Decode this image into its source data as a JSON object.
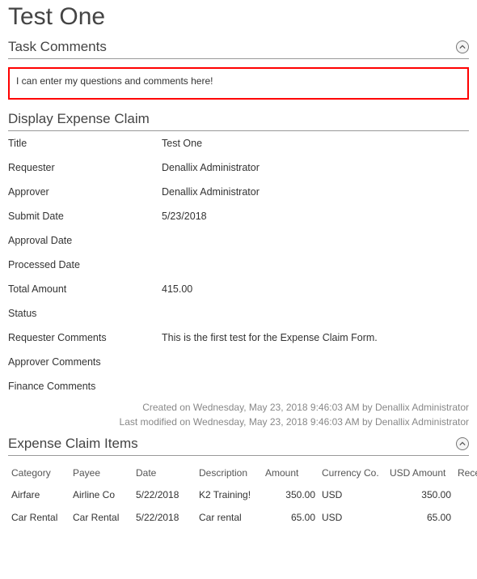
{
  "title": "Test One",
  "sections": {
    "task_comments": {
      "title": "Task Comments"
    },
    "display_claim": {
      "title": "Display Expense Claim"
    },
    "items": {
      "title": "Expense Claim Items"
    }
  },
  "task_comments": {
    "value": "I can enter my questions and comments here!"
  },
  "claim": {
    "labels": {
      "title": "Title",
      "requester": "Requester",
      "approver": "Approver",
      "submit_date": "Submit Date",
      "approval_date": "Approval Date",
      "processed_date": "Processed Date",
      "total_amount": "Total Amount",
      "status": "Status",
      "requester_comments": "Requester Comments",
      "approver_comments": "Approver Comments",
      "finance_comments": "Finance Comments"
    },
    "values": {
      "title": "Test One",
      "requester": "Denallix Administrator",
      "approver": "Denallix Administrator",
      "submit_date": "5/23/2018",
      "approval_date": "",
      "processed_date": "",
      "total_amount": "415.00",
      "status": "",
      "requester_comments": "This is the first test for the Expense Claim Form.",
      "approver_comments": "",
      "finance_comments": ""
    }
  },
  "audit": {
    "created": "Created on  Wednesday, May 23, 2018 9:46:03 AM by  Denallix Administrator",
    "modified": "Last modified on  Wednesday, May 23, 2018 9:46:03 AM by  Denallix Administrator"
  },
  "items": {
    "headers": {
      "category": "Category",
      "payee": "Payee",
      "date": "Date",
      "description": "Description",
      "amount": "Amount",
      "currency": "Currency Co.",
      "usd_amount": "USD Amount",
      "receipt": "Receipt"
    },
    "rows": [
      {
        "category": "Airfare",
        "payee": "Airline Co",
        "date": "5/22/2018",
        "description": "K2 Training!",
        "amount": "350.00",
        "currency": "USD",
        "usd_amount": "350.00",
        "receipt": ""
      },
      {
        "category": "Car Rental",
        "payee": "Car Rental",
        "date": "5/22/2018",
        "description": "Car rental",
        "amount": "65.00",
        "currency": "USD",
        "usd_amount": "65.00",
        "receipt": ""
      }
    ]
  }
}
